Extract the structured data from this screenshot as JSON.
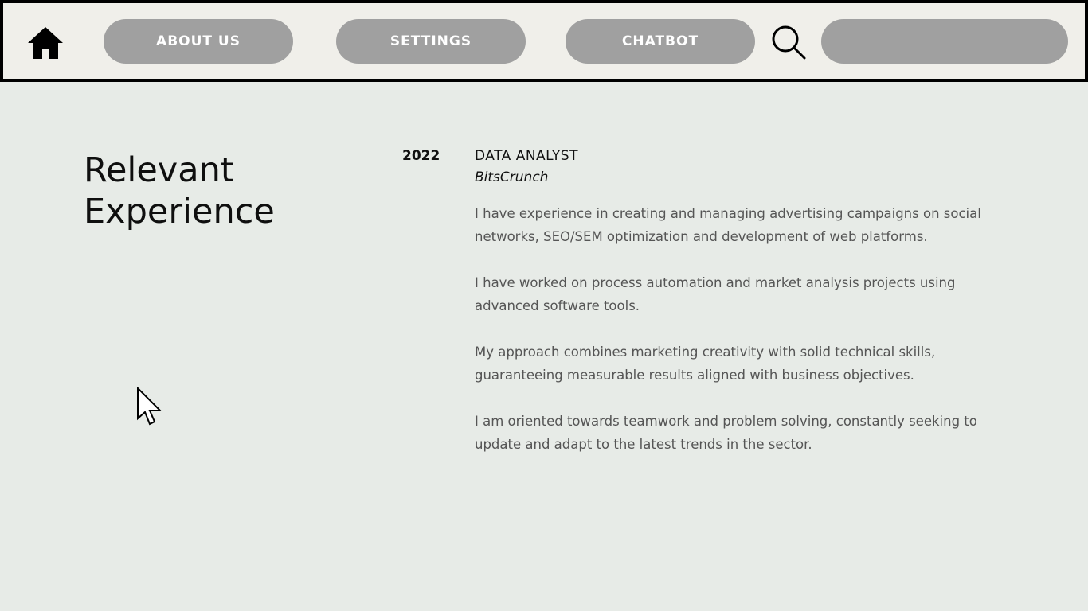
{
  "nav": {
    "home_icon": "home-icon",
    "about_label": "ABOUT US",
    "settings_label": "SETTINGS",
    "chatbot_label": "CHATBOT",
    "search_icon": "search-icon",
    "search_value": ""
  },
  "section": {
    "title_line1": "Relevant",
    "title_line2": "Experience"
  },
  "entry": {
    "year": "2022",
    "role": "DATA ANALYST",
    "company": "BitsCrunch",
    "paragraphs": [
      "I have experience in creating and managing advertising campaigns on social networks, SEO/SEM optimization and development of web platforms.",
      "I have worked on process automation and market analysis projects using advanced software tools.",
      "My approach combines marketing creativity with solid technical skills, guaranteeing measurable results aligned with business objectives.",
      "I am oriented towards teamwork and problem solving, constantly seeking to update and adapt to the latest trends in the sector."
    ]
  },
  "colors": {
    "navbar_bg": "#f0efea",
    "pill_bg": "#a0a0a0",
    "page_bg": "#e7ebe7",
    "body_text": "#555555"
  }
}
